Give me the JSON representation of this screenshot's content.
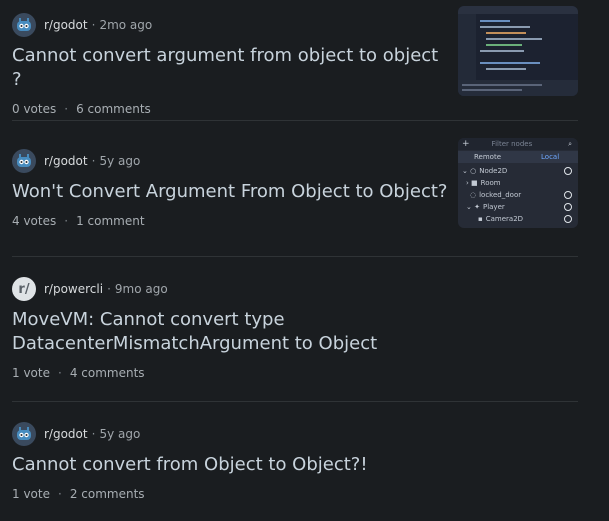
{
  "posts": [
    {
      "subreddit": "r/godot",
      "age": "2mo ago",
      "title": "Cannot convert argument from object to object ?",
      "votes": "0 votes",
      "comments": "6 comments",
      "avatar_icon": "godot-robot-icon"
    },
    {
      "subreddit": "r/godot",
      "age": "5y ago",
      "title": "Won't Convert Argument From Object to Object?",
      "votes": "4 votes",
      "comments": "1 comment",
      "avatar_icon": "godot-robot-icon",
      "thumbnail": {
        "search_placeholder": "Filter nodes",
        "tab_remote": "Remote",
        "tab_local": "Local",
        "nodes": [
          "Node2D",
          "Room",
          "locked_door",
          "Player",
          "Camera2D"
        ]
      }
    },
    {
      "subreddit": "r/powercli",
      "age": "9mo ago",
      "title": "MoveVM: Cannot convert type DatacenterMismatchArgument to Object",
      "votes": "1 vote",
      "comments": "4 comments",
      "avatar_letters": "r/"
    },
    {
      "subreddit": "r/godot",
      "age": "5y ago",
      "title": "Cannot convert from Object to Object?!",
      "votes": "1 vote",
      "comments": "2 comments",
      "avatar_icon": "godot-robot-icon"
    }
  ],
  "separator": "·",
  "colors": {
    "background": "#1a1d20",
    "title": "#c8d3dc",
    "meta": "#a8aeb3",
    "divider": "#2f3336",
    "local_tab_accent": "#6fa8ff"
  }
}
